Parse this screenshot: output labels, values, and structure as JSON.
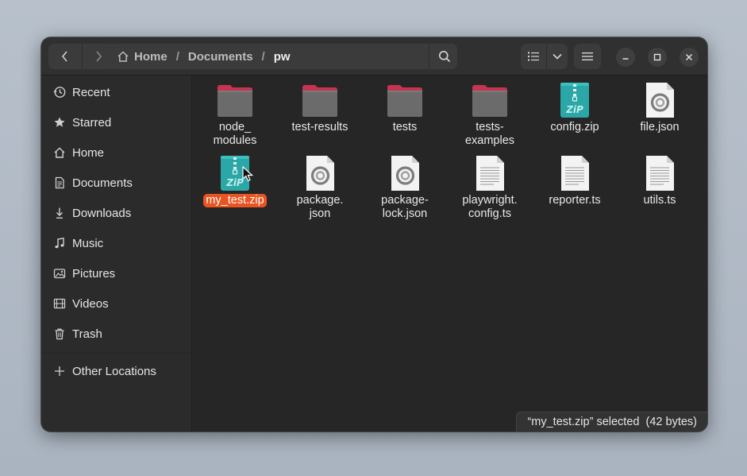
{
  "header": {
    "back_icon": "chevron-left-icon",
    "forward_icon": "chevron-right-icon",
    "breadcrumbs": [
      "Home",
      "Documents",
      "pw"
    ],
    "separator": "/",
    "path_menu_icon": "vertical-dots-icon",
    "search_icon": "search-icon",
    "view_list_icon": "list-view-icon",
    "view_options_icon": "chevron-down-icon",
    "main_menu_icon": "hamburger-icon",
    "minimize_icon": "minimize-icon",
    "maximize_icon": "maximize-icon",
    "close_icon": "close-icon"
  },
  "sidebar": {
    "items": [
      {
        "label": "Recent",
        "icon": "clock-icon"
      },
      {
        "label": "Starred",
        "icon": "star-icon"
      },
      {
        "label": "Home",
        "icon": "home-icon"
      },
      {
        "label": "Documents",
        "icon": "document-icon"
      },
      {
        "label": "Downloads",
        "icon": "download-icon"
      },
      {
        "label": "Music",
        "icon": "music-icon"
      },
      {
        "label": "Pictures",
        "icon": "picture-icon"
      },
      {
        "label": "Videos",
        "icon": "video-icon"
      },
      {
        "label": "Trash",
        "icon": "trash-icon"
      }
    ],
    "other_locations": {
      "label": "Other Locations",
      "icon": "plus-icon"
    }
  },
  "files": [
    {
      "label": "node_\nmodules",
      "type": "folder"
    },
    {
      "label": "test-results",
      "type": "folder"
    },
    {
      "label": "tests",
      "type": "folder"
    },
    {
      "label": "tests-\nexamples",
      "type": "folder"
    },
    {
      "label": "config.zip",
      "type": "zip"
    },
    {
      "label": "file.json",
      "type": "json"
    },
    {
      "label": "my_test.zip",
      "type": "zip",
      "selected": true
    },
    {
      "label": "package.\njson",
      "type": "json"
    },
    {
      "label": "package-\nlock.json",
      "type": "json"
    },
    {
      "label": "playwright.\nconfig.ts",
      "type": "text"
    },
    {
      "label": "reporter.ts",
      "type": "text"
    },
    {
      "label": "utils.ts",
      "type": "text"
    }
  ],
  "status": {
    "text": "“my_test.zip” selected  (42 bytes)"
  },
  "colors": {
    "accent": "#e95420",
    "folder": "#6b6b6b",
    "folder_tab": "#c7344f",
    "zip": "#2aa7a6"
  }
}
